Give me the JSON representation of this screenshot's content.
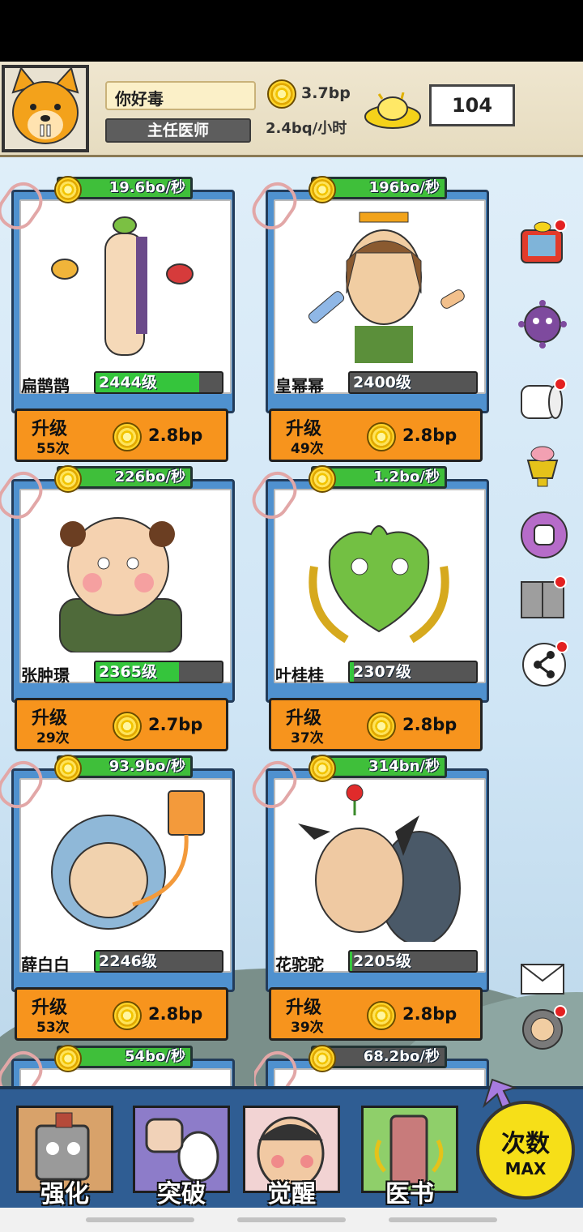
{
  "player": {
    "name": "你好毒",
    "title": "主任医师",
    "money": "3.7bp",
    "income_rate": "2.4bq/小时",
    "gold": "104"
  },
  "cards": [
    {
      "rate": "19.6bo/秒",
      "name": "扁鹊鹊",
      "level": "2444级",
      "level_progress": 0.82,
      "upgrade": "升级",
      "times": "55次",
      "cost": "2.8bp"
    },
    {
      "rate": "196bo/秒",
      "name": "皇幂幂",
      "level": "2400级",
      "level_progress": 0.0,
      "upgrade": "升级",
      "times": "49次",
      "cost": "2.8bp"
    },
    {
      "rate": "226bo/秒",
      "name": "张肿璟",
      "level": "2365级",
      "level_progress": 0.66,
      "upgrade": "升级",
      "times": "29次",
      "cost": "2.7bp"
    },
    {
      "rate": "1.2bo/秒",
      "name": "叶桂桂",
      "level": "2307级",
      "level_progress": 0.03,
      "upgrade": "升级",
      "times": "37次",
      "cost": "2.8bp"
    },
    {
      "rate": "93.9bo/秒",
      "name": "薛白白",
      "level": "2246级",
      "level_progress": 0.03,
      "upgrade": "升级",
      "times": "53次",
      "cost": "2.8bp"
    },
    {
      "rate": "314bn/秒",
      "name": "花驼驼",
      "level": "2205级",
      "level_progress": 0.02,
      "upgrade": "升级",
      "times": "39次",
      "cost": "2.8bp"
    },
    {
      "rate": "54bo/秒"
    },
    {
      "rate": "68.2bo/秒"
    }
  ],
  "side_icons": [
    "tv-gift-icon",
    "virus-icon",
    "toilet-paper-icon",
    "brain-trophy-icon",
    "fist-icon",
    "calendar-book-icon",
    "share-icon",
    "mail-icon",
    "doctor-gear-icon"
  ],
  "tabs": [
    {
      "label": "强化",
      "icon": "robot-icon"
    },
    {
      "label": "突破",
      "icon": "fist-toilet-icon"
    },
    {
      "label": "觉醒",
      "icon": "face-icon"
    },
    {
      "label": "医书",
      "icon": "book-character-icon"
    }
  ],
  "max_button": {
    "line1": "次数",
    "line2": "MAX"
  },
  "colors": {
    "card_blue": "#4f91cf",
    "upgrade_orange": "#f7941d",
    "level_green": "#35c53c",
    "max_yellow": "#f6df18"
  }
}
